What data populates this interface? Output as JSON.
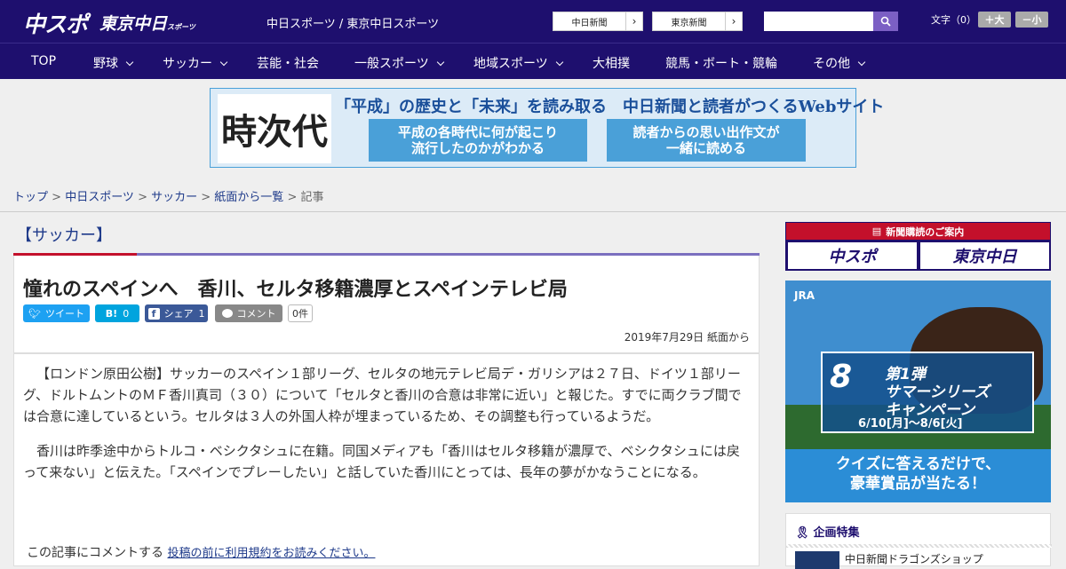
{
  "header": {
    "logo_primary": "中スポ",
    "logo_secondary": "東京中日",
    "logo_secondary_small": "スポーツ",
    "site_name": "中日スポーツ / 東京中日スポーツ",
    "paper_buttons": [
      "中日新聞",
      "東京新聞"
    ],
    "font_size_label": "文字（0）",
    "font_larger": "＋大",
    "font_smaller": "－小"
  },
  "nav": {
    "items": [
      {
        "label": "TOP",
        "dropdown": false
      },
      {
        "label": "野球",
        "dropdown": true
      },
      {
        "label": "サッカー",
        "dropdown": true
      },
      {
        "label": "芸能・社会",
        "dropdown": false
      },
      {
        "label": "一般スポーツ",
        "dropdown": true
      },
      {
        "label": "地域スポーツ",
        "dropdown": true
      },
      {
        "label": "大相撲",
        "dropdown": false
      },
      {
        "label": "競馬・ボート・競輪",
        "dropdown": false
      },
      {
        "label": "その他",
        "dropdown": true
      }
    ]
  },
  "banner": {
    "kanji": "時次代",
    "headline": "「平成」の歴史と「未来」を読み取る　中日新聞と読者がつくるWebサイト",
    "box1": "平成の各時代に何が起こり\n流行したのかがわかる",
    "box2": "読者からの思い出作文が\n一緒に読める"
  },
  "breadcrumb": {
    "links": [
      "トップ",
      "中日スポーツ",
      "サッカー",
      "紙面から一覧"
    ],
    "current": "記事",
    "separator": " > "
  },
  "article": {
    "category": "【サッカー】",
    "title": "憧れのスペインへ　香川、セルタ移籍濃厚とスペインテレビ局",
    "share": {
      "tweet": "ツイート",
      "hatena": "B!",
      "hatena_count": "0",
      "facebook": "シェア",
      "facebook_count": "1",
      "comment": "コメント",
      "comment_count": "0件"
    },
    "date": "2019年7月29日 紙面から",
    "paragraphs": [
      "【ロンドン原田公樹】サッカーのスペイン１部リーグ、セルタの地元テレビ局デ・ガリシアは２７日、ドイツ１部リーグ、ドルトムントのＭＦ香川真司（３０）について「セルタと香川の合意は非常に近い」と報じた。すでに両クラブ間では合意に達しているという。セルタは３人の外国人枠が埋まっているため、その調整も行っているようだ。",
      "香川は昨季途中からトルコ・ベシクタシュに在籍。同国メディアも「香川はセルタ移籍が濃厚で、ベシクタシュには戻って来ない」と伝えた。「スペインでプレーしたい」と話していた香川にとっては、長年の夢がかなうことになる。"
    ],
    "comment_prompt": "この記事にコメントする",
    "comment_link": "投稿の前に利用規約をお読みください。"
  },
  "sidebar": {
    "subscribe_header": "新聞購読のご案内",
    "subscribe_logos": [
      "中スポ",
      "東京中日"
    ],
    "ad": {
      "brand": "JRA",
      "number": "8",
      "campaign": "第1弾\nサマーシリーズ\nキャンペーン",
      "dates": "6/10[月]～8/6[火]",
      "footer": "クイズに答えるだけで、\n豪華賞品が当たる！"
    },
    "feature_header": "企画特集",
    "feature_item": "中日新聞ドラゴンズショップ"
  },
  "colors": {
    "brand_navy": "#1e0f6e",
    "accent_red": "#c3102b",
    "link": "#1e3a8a"
  }
}
